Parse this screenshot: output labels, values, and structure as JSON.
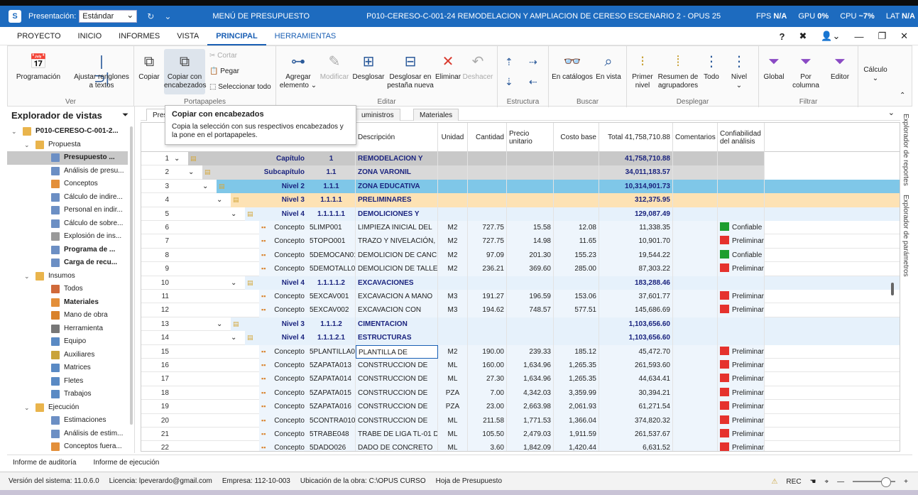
{
  "titlebar": {
    "presentacion_label": "Presentación:",
    "presentacion_value": "Estándar",
    "menu_label": "MENÚ DE PRESUPUESTO",
    "window_title": "P010-CERESO-C-001-24 REMODELACION Y AMPLIACION DE CERESO ESCENARIO 2 - OPUS 25",
    "fps_label": "FPS",
    "fps_value": "N/A",
    "gpu_label": "GPU",
    "gpu_value": "0%",
    "cpu_label": "CPU",
    "cpu_value": "~7%",
    "lat_label": "LAT",
    "lat_value": "N/A"
  },
  "menubar": {
    "items": [
      "PROYECTO",
      "INICIO",
      "INFORMES",
      "VISTA",
      "PRINCIPAL",
      "HERRAMIENTAS"
    ],
    "help": "?"
  },
  "ribbon": {
    "groups": {
      "ver": "Ver",
      "portapapeles": "Portapapeles",
      "editar": "Editar",
      "estructura": "Estructura",
      "buscar": "Buscar",
      "desplegar": "Desplegar",
      "filtrar": "Filtrar"
    },
    "buttons": {
      "programacion": "Programación",
      "ajustar": "Ajustar renglones a textos",
      "copiar": "Copiar",
      "copiar_enc": "Copiar con encabezados",
      "cortar": "Cortar",
      "pegar": "Pegar",
      "seleccionar": "Seleccionar todo",
      "agregar": "Agregar elemento",
      "modificar": "Modificar",
      "desglosar": "Desglosar",
      "desglosar_nueva": "Desglosar en pestaña nueva",
      "eliminar": "Eliminar",
      "deshacer": "Deshacer",
      "en_catalogos": "En catálogos",
      "en_vista": "En vista",
      "primer_nivel": "Primer nivel",
      "resumen": "Resumen de agrupadores",
      "todo": "Todo",
      "nivel": "Nivel",
      "global": "Global",
      "por_columna": "Por columna",
      "editor": "Editor",
      "calculo": "Cálculo"
    }
  },
  "explorer": {
    "title": "Explorador de vistas",
    "items": [
      {
        "label": "P010-CERESO-C-001-2...",
        "level": 0,
        "chev": "⌄",
        "bold": true,
        "color": "#e9b44c"
      },
      {
        "label": "Propuesta",
        "level": 1,
        "chev": "⌄",
        "bold": false,
        "color": "#e9b44c"
      },
      {
        "label": "Presupuesto ...",
        "level": 2,
        "chev": "",
        "bold": true,
        "color": "#6c8fc4",
        "sel": true
      },
      {
        "label": "Análisis de presu...",
        "level": 2,
        "chev": "",
        "bold": false,
        "color": "#6c8fc4"
      },
      {
        "label": "Conceptos",
        "level": 2,
        "chev": "",
        "bold": false,
        "color": "#e38f3a"
      },
      {
        "label": "Cálculo de indire...",
        "level": 2,
        "chev": "",
        "bold": false,
        "color": "#6c8fc4"
      },
      {
        "label": "Personal en indir...",
        "level": 2,
        "chev": "",
        "bold": false,
        "color": "#6c8fc4"
      },
      {
        "label": "Cálculo de sobre...",
        "level": 2,
        "chev": "",
        "bold": false,
        "color": "#6c8fc4"
      },
      {
        "label": "Explosión de ins...",
        "level": 2,
        "chev": "",
        "bold": false,
        "color": "#9a9a9a"
      },
      {
        "label": "Programa de ...",
        "level": 2,
        "chev": "",
        "bold": true,
        "color": "#6c8fc4"
      },
      {
        "label": "Carga de recu...",
        "level": 2,
        "chev": "",
        "bold": true,
        "color": "#6c8fc4"
      },
      {
        "label": "Insumos",
        "level": 1,
        "chev": "⌄",
        "bold": false,
        "color": "#e9b44c"
      },
      {
        "label": "Todos",
        "level": 2,
        "chev": "",
        "bold": false,
        "color": "#d06a3a"
      },
      {
        "label": "Materiales",
        "level": 2,
        "chev": "",
        "bold": true,
        "color": "#e38f3a"
      },
      {
        "label": "Mano de obra",
        "level": 2,
        "chev": "",
        "bold": false,
        "color": "#d9822b"
      },
      {
        "label": "Herramienta",
        "level": 2,
        "chev": "",
        "bold": false,
        "color": "#777"
      },
      {
        "label": "Equipo",
        "level": 2,
        "chev": "",
        "bold": false,
        "color": "#5a8ac4"
      },
      {
        "label": "Auxiliares",
        "level": 2,
        "chev": "",
        "bold": false,
        "color": "#c9a33a"
      },
      {
        "label": "Matrices",
        "level": 2,
        "chev": "",
        "bold": false,
        "color": "#5a8ac4"
      },
      {
        "label": "Fletes",
        "level": 2,
        "chev": "",
        "bold": false,
        "color": "#5a8ac4"
      },
      {
        "label": "Trabajos",
        "level": 2,
        "chev": "",
        "bold": false,
        "color": "#5a8ac4"
      },
      {
        "label": "Ejecución",
        "level": 1,
        "chev": "⌄",
        "bold": false,
        "color": "#e9b44c"
      },
      {
        "label": "Estimaciones",
        "level": 2,
        "chev": "",
        "bold": false,
        "color": "#6c8fc4"
      },
      {
        "label": "Análisis de estim...",
        "level": 2,
        "chev": "",
        "bold": false,
        "color": "#6c8fc4"
      },
      {
        "label": "Conceptos fuera...",
        "level": 2,
        "chev": "",
        "bold": false,
        "color": "#e38f3a"
      }
    ]
  },
  "tabs": [
    "Pres",
    "uministros",
    "Materiales"
  ],
  "tooltip": {
    "title": "Copiar con encabezados",
    "body": "Copia la selección con sus respectivos encabezados y la pone en el portapapeles."
  },
  "grid": {
    "headers": {
      "descripcion": "Descripción",
      "unidad": "Unidad",
      "cantidad": "Cantidad",
      "precio": "Precio unitario",
      "costo": "Costo base",
      "total": "Total 41,758,710.88",
      "comentarios": "Comentarios",
      "confiabilidad": "Confiabilidad del análisis"
    },
    "rows": [
      {
        "n": "1",
        "indent": 0,
        "chev": "⌄",
        "tipo": "Capítulo",
        "clave": "1",
        "desc": "REMODELACION Y",
        "unidad": "",
        "cant": "",
        "pu": "",
        "cb": "",
        "total": "41,758,710.88",
        "conf": "",
        "kind": "cap"
      },
      {
        "n": "2",
        "indent": 1,
        "chev": "⌄",
        "tipo": "Subcapítulo",
        "clave": "1.1",
        "desc": "ZONA VARONIL",
        "unidad": "",
        "cant": "",
        "pu": "",
        "cb": "",
        "total": "34,011,183.57",
        "conf": "",
        "kind": "sub"
      },
      {
        "n": "3",
        "indent": 2,
        "chev": "⌄",
        "tipo": "Nivel 2",
        "clave": "1.1.1",
        "desc": "ZONA EDUCATIVA",
        "unidad": "",
        "cant": "",
        "pu": "",
        "cb": "",
        "total": "10,314,901.73",
        "conf": "",
        "kind": "n2"
      },
      {
        "n": "4",
        "indent": 3,
        "chev": "⌄",
        "tipo": "Nivel 3",
        "clave": "1.1.1.1",
        "desc": "PRELIMINARES",
        "unidad": "",
        "cant": "",
        "pu": "",
        "cb": "",
        "total": "312,375.95",
        "conf": "",
        "kind": "n3"
      },
      {
        "n": "5",
        "indent": 4,
        "chev": "⌄",
        "tipo": "Nivel 4",
        "clave": "1.1.1.1.1",
        "desc": "DEMOLICIONES Y",
        "unidad": "",
        "cant": "",
        "pu": "",
        "cb": "",
        "total": "129,087.49",
        "conf": "",
        "kind": "n4"
      },
      {
        "n": "6",
        "indent": 5,
        "chev": "",
        "tipo": "Concepto",
        "clave": "5LIMP001",
        "desc": "LIMPIEZA INICIAL DEL",
        "unidad": "M2",
        "cant": "727.75",
        "pu": "15.58",
        "cb": "12.08",
        "total": "11,338.35",
        "conf": "Confiable",
        "kind": "con"
      },
      {
        "n": "7",
        "indent": 5,
        "chev": "",
        "tipo": "Concepto",
        "clave": "5TOPO001",
        "desc": "TRAZO Y NIVELACIÓN, DE",
        "unidad": "M2",
        "cant": "727.75",
        "pu": "14.98",
        "cb": "11.65",
        "total": "10,901.70",
        "conf": "Preliminar",
        "kind": "con"
      },
      {
        "n": "8",
        "indent": 5,
        "chev": "",
        "tipo": "Concepto",
        "clave": "5DEMOCAN01",
        "desc": "DEMOLICION DE CANCHA",
        "unidad": "M2",
        "cant": "97.09",
        "pu": "201.30",
        "cb": "155.23",
        "total": "19,544.22",
        "conf": "Confiable",
        "kind": "con"
      },
      {
        "n": "9",
        "indent": 5,
        "chev": "",
        "tipo": "Concepto",
        "clave": "5DEMOTALL01",
        "desc": "DEMOLICION DE TALLER",
        "unidad": "M2",
        "cant": "236.21",
        "pu": "369.60",
        "cb": "285.00",
        "total": "87,303.22",
        "conf": "Preliminar",
        "kind": "con"
      },
      {
        "n": "10",
        "indent": 4,
        "chev": "⌄",
        "tipo": "Nivel 4",
        "clave": "1.1.1.1.2",
        "desc": "EXCAVACIONES",
        "unidad": "",
        "cant": "",
        "pu": "",
        "cb": "",
        "total": "183,288.46",
        "conf": "",
        "kind": "n4"
      },
      {
        "n": "11",
        "indent": 5,
        "chev": "",
        "tipo": "Concepto",
        "clave": "5EXCAV001",
        "desc": "EXCAVACION A MANO",
        "unidad": "M3",
        "cant": "191.27",
        "pu": "196.59",
        "cb": "153.06",
        "total": "37,601.77",
        "conf": "Preliminar",
        "kind": "con"
      },
      {
        "n": "12",
        "indent": 5,
        "chev": "",
        "tipo": "Concepto",
        "clave": "5EXCAV002",
        "desc": "EXCAVACION CON",
        "unidad": "M3",
        "cant": "194.62",
        "pu": "748.57",
        "cb": "577.51",
        "total": "145,686.69",
        "conf": "Preliminar",
        "kind": "con"
      },
      {
        "n": "13",
        "indent": 3,
        "chev": "⌄",
        "tipo": "Nivel 3",
        "clave": "1.1.1.2",
        "desc": "CIMENTACION",
        "unidad": "",
        "cant": "",
        "pu": "",
        "cb": "",
        "total": "1,103,656.60",
        "conf": "",
        "kind": "n4"
      },
      {
        "n": "14",
        "indent": 4,
        "chev": "⌄",
        "tipo": "Nivel 4",
        "clave": "1.1.1.2.1",
        "desc": "ESTRUCTURAS",
        "unidad": "",
        "cant": "",
        "pu": "",
        "cb": "",
        "total": "1,103,656.60",
        "conf": "",
        "kind": "n4"
      },
      {
        "n": "15",
        "indent": 5,
        "chev": "",
        "tipo": "Concepto",
        "clave": "5PLANTILLA01",
        "desc": "PLANTILLA DE",
        "unidad": "M2",
        "cant": "190.00",
        "pu": "239.33",
        "cb": "185.12",
        "total": "45,472.70",
        "conf": "Preliminar",
        "kind": "con",
        "editing": true
      },
      {
        "n": "16",
        "indent": 5,
        "chev": "",
        "tipo": "Concepto",
        "clave": "5ZAPATA013",
        "desc": "CONSTRUCCION DE",
        "unidad": "ML",
        "cant": "160.00",
        "pu": "1,634.96",
        "cb": "1,265.35",
        "total": "261,593.60",
        "conf": "Preliminar",
        "kind": "con"
      },
      {
        "n": "17",
        "indent": 5,
        "chev": "",
        "tipo": "Concepto",
        "clave": "5ZAPATA014",
        "desc": "CONSTRUCCION DE",
        "unidad": "ML",
        "cant": "27.30",
        "pu": "1,634.96",
        "cb": "1,265.35",
        "total": "44,634.41",
        "conf": "Preliminar",
        "kind": "con"
      },
      {
        "n": "18",
        "indent": 5,
        "chev": "",
        "tipo": "Concepto",
        "clave": "5ZAPATA015",
        "desc": "CONSTRUCCION DE",
        "unidad": "PZA",
        "cant": "7.00",
        "pu": "4,342.03",
        "cb": "3,359.99",
        "total": "30,394.21",
        "conf": "Preliminar",
        "kind": "con"
      },
      {
        "n": "19",
        "indent": 5,
        "chev": "",
        "tipo": "Concepto",
        "clave": "5ZAPATA016",
        "desc": "CONSTRUCCION DE",
        "unidad": "PZA",
        "cant": "23.00",
        "pu": "2,663.98",
        "cb": "2,061.93",
        "total": "61,271.54",
        "conf": "Preliminar",
        "kind": "con"
      },
      {
        "n": "20",
        "indent": 5,
        "chev": "",
        "tipo": "Concepto",
        "clave": "5CONTRA010",
        "desc": "CONSTRUCCION DE",
        "unidad": "ML",
        "cant": "211.58",
        "pu": "1,771.53",
        "cb": "1,366.04",
        "total": "374,820.32",
        "conf": "Preliminar",
        "kind": "con"
      },
      {
        "n": "21",
        "indent": 5,
        "chev": "",
        "tipo": "Concepto",
        "clave": "5TRABE048",
        "desc": "TRABE DE LIGA TL-01 DE",
        "unidad": "ML",
        "cant": "105.50",
        "pu": "2,479.03",
        "cb": "1,911.59",
        "total": "261,537.67",
        "conf": "Preliminar",
        "kind": "con"
      },
      {
        "n": "22",
        "indent": 5,
        "chev": "",
        "tipo": "Concepto",
        "clave": "5DADO026",
        "desc": "DADO DE CONCRETO",
        "unidad": "ML",
        "cant": "3.60",
        "pu": "1,842.09",
        "cb": "1,420.44",
        "total": "6,631.52",
        "conf": "Preliminar",
        "kind": "con"
      }
    ]
  },
  "right_panels": {
    "reportes": "Explorador de reportes",
    "parametros": "Explorador de parámetros"
  },
  "footer_tabs": [
    "Informe de auditoría",
    "Informe de ejecución"
  ],
  "status": {
    "version": "Versión del sistema: 11.0.6.0",
    "licencia": "Licencia: lpeverardo@gmail.com",
    "empresa": "Empresa: 112-10-003",
    "ubicacion": "Ubicación de la obra: C:\\OPUS CURSO",
    "hoja": "Hoja de Presupuesto",
    "rec": "REC"
  },
  "colors": {
    "titlebar": "#1d6bbf",
    "capitulo": "#c8c8c8",
    "subcapitulo": "#d9d9d9",
    "nivel2": "#7fc7e8",
    "nivel3": "#fde2b4",
    "nivel4": "#e6f1fb",
    "concepto": "#eef5fc",
    "confiable": "#1e9e2e",
    "preliminar": "#e5322d"
  }
}
